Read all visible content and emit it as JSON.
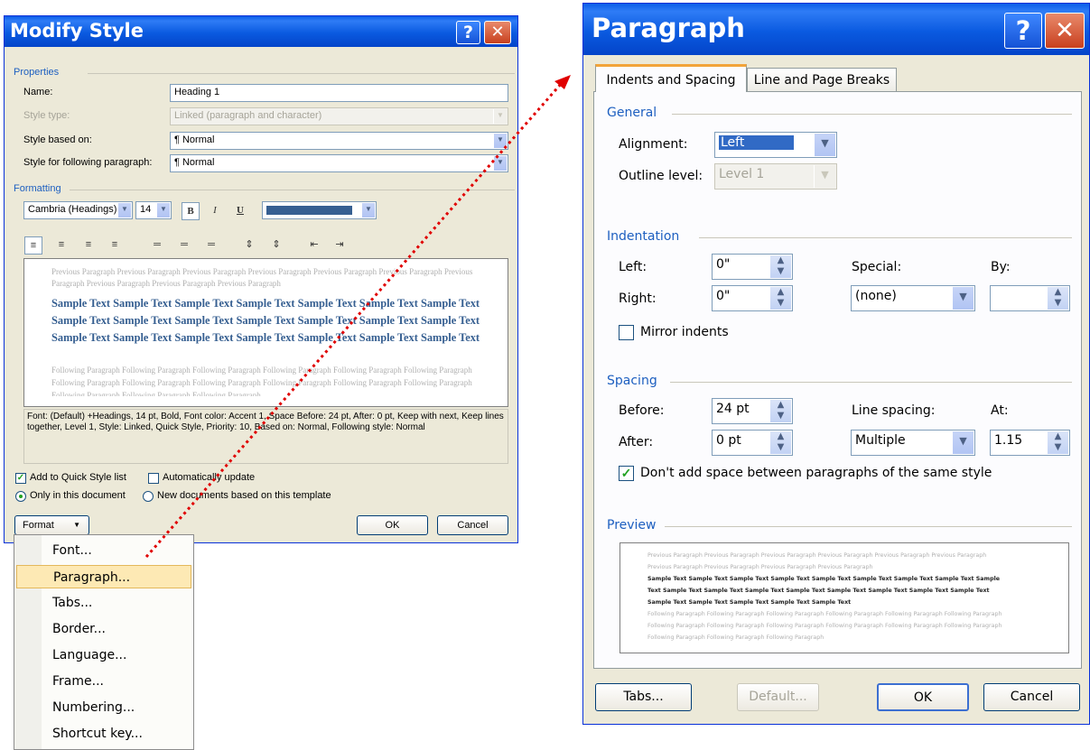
{
  "modify_style": {
    "title": "Modify Style",
    "help_label": "?",
    "close_label": "✕",
    "properties": {
      "heading": "Properties",
      "name_label": "Name:",
      "name_value": "Heading 1",
      "style_type_label": "Style type:",
      "style_type_value": "Linked (paragraph and character)",
      "based_on_label": "Style based on:",
      "based_on_value": "¶ Normal",
      "following_label": "Style for following paragraph:",
      "following_value": "¶ Normal"
    },
    "formatting": {
      "heading": "Formatting",
      "font": "Cambria (Headings)",
      "size": "14",
      "bold": "B",
      "italic": "I",
      "underline": "U"
    },
    "preview": {
      "previous": "Previous Paragraph Previous Paragraph Previous Paragraph Previous Paragraph Previous Paragraph Previous Paragraph Previous Paragraph Previous Paragraph Previous Paragraph Previous Paragraph",
      "sample": "Sample Text Sample Text Sample Text Sample Text Sample Text Sample Text Sample Text Sample Text Sample Text Sample Text Sample Text Sample Text Sample Text Sample Text Sample Text Sample Text Sample Text Sample Text Sample Text Sample Text Sample Text",
      "following": "Following Paragraph Following Paragraph Following Paragraph Following Paragraph Following Paragraph Following Paragraph Following Paragraph Following Paragraph Following Paragraph Following Paragraph Following Paragraph Following Paragraph Following Paragraph Following Paragraph Following Paragraph"
    },
    "description": "Font: (Default) +Headings, 14 pt, Bold, Font color: Accent 1, Space Before: 24 pt, After: 0 pt, Keep with next, Keep lines together, Level 1, Style: Linked, Quick Style, Priority: 10, Based on: Normal, Following style: Normal",
    "add_quick_style": "Add to Quick Style list",
    "auto_update": "Automatically update",
    "only_this_doc": "Only in this document",
    "new_docs": "New documents based on this template",
    "format_button": "Format",
    "ok": "OK",
    "cancel": "Cancel"
  },
  "format_menu": {
    "items": [
      "Font...",
      "Paragraph...",
      "Tabs...",
      "Border...",
      "Language...",
      "Frame...",
      "Numbering...",
      "Shortcut key..."
    ],
    "highlighted": "Paragraph..."
  },
  "paragraph": {
    "title": "Paragraph",
    "help_label": "?",
    "close_label": "✕",
    "tabs": [
      "Indents and Spacing",
      "Line and Page Breaks"
    ],
    "general": {
      "heading": "General",
      "alignment_label": "Alignment:",
      "alignment_value": "Left",
      "outline_label": "Outline level:",
      "outline_value": "Level 1"
    },
    "indentation": {
      "heading": "Indentation",
      "left_label": "Left:",
      "left_value": "0\"",
      "right_label": "Right:",
      "right_value": "0\"",
      "special_label": "Special:",
      "special_value": "(none)",
      "by_label": "By:",
      "by_value": "",
      "mirror_label": "Mirror indents"
    },
    "spacing": {
      "heading": "Spacing",
      "before_label": "Before:",
      "before_value": "24 pt",
      "after_label": "After:",
      "after_value": "0 pt",
      "line_spacing_label": "Line spacing:",
      "line_spacing_value": "Multiple",
      "at_label": "At:",
      "at_value": "1.15",
      "dont_add_label": "Don't add space between paragraphs of the same style"
    },
    "preview": {
      "heading": "Preview",
      "previous": "Previous Paragraph Previous Paragraph Previous Paragraph Previous Paragraph Previous Paragraph Previous Paragraph Previous Paragraph Previous Paragraph Previous Paragraph Previous Paragraph",
      "sample": "Sample Text Sample Text Sample Text Sample Text Sample Text Sample Text Sample Text Sample Text Sample Text Sample Text Sample Text Sample Text Sample Text Sample Text Sample Text Sample Text Sample Text Sample Text Sample Text Sample Text Sample Text Sample Text",
      "following": "Following Paragraph Following Paragraph Following Paragraph Following Paragraph Following Paragraph Following Paragraph Following Paragraph Following Paragraph Following Paragraph Following Paragraph Following Paragraph Following Paragraph Following Paragraph Following Paragraph Following Paragraph"
    },
    "tabs_button": "Tabs...",
    "default_button": "Default...",
    "ok": "OK",
    "cancel": "Cancel"
  },
  "colors": {
    "titlebar": "#0a5ae0",
    "accent_text": "#1d5fc0",
    "heading_blue": "#365f91",
    "highlight": "#fde9b4",
    "arrow": "#e00000"
  }
}
